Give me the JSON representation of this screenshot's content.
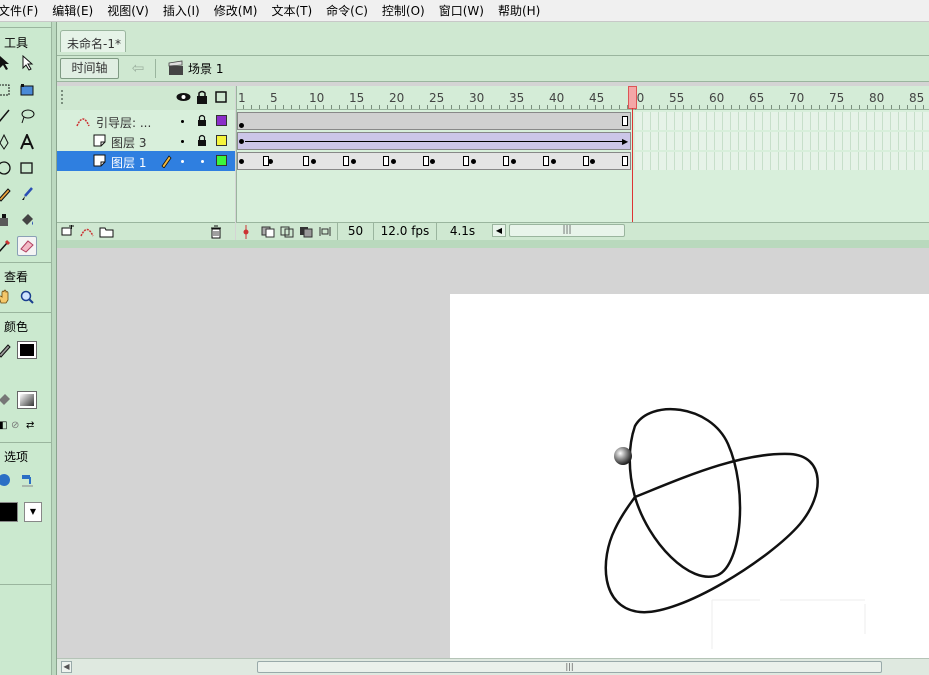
{
  "menubar": {
    "items": [
      "文件(F)",
      "编辑(E)",
      "视图(V)",
      "插入(I)",
      "修改(M)",
      "文本(T)",
      "命令(C)",
      "控制(O)",
      "窗口(W)",
      "帮助(H)"
    ]
  },
  "tools_panel": {
    "tools_title": "工具",
    "view_title": "查看",
    "colors_title": "颜色",
    "options_title": "选项"
  },
  "document": {
    "tab_title": "未命名-1*",
    "timeline_button": "时间轴",
    "scene_label": "场景 1"
  },
  "timeline": {
    "ruler_labels": [
      "1",
      "5",
      "10",
      "15",
      "20",
      "25",
      "30",
      "35",
      "40",
      "45",
      "50",
      "55",
      "60",
      "65",
      "70",
      "75",
      "80",
      "85"
    ],
    "layers": [
      {
        "name": "引导层: ...",
        "swatch_color": "#8b2fc9",
        "selected": false
      },
      {
        "name": "图层 3",
        "swatch_color": "#f5f53c",
        "selected": false
      },
      {
        "name": "图层 1",
        "swatch_color": "#3cf53c",
        "selected": true
      }
    ],
    "current_frame": "50",
    "frame_rate": "12.0 fps",
    "elapsed_time": "4.1s"
  },
  "colors": {
    "accent_selected": "#2f7fe0",
    "panel_bg": "#cbe9cf",
    "playhead": "#d33333"
  }
}
